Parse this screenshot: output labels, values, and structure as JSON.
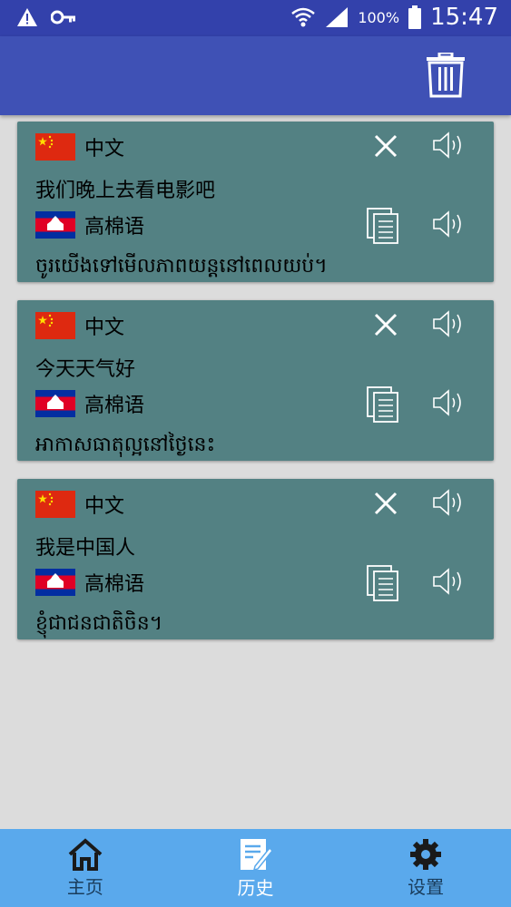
{
  "status": {
    "battery": "100%",
    "time": "15:47"
  },
  "cards": [
    {
      "source_lang": "中文",
      "source_text": "我们晚上去看电影吧",
      "target_lang": "高棉语",
      "target_text": "ចូរយើងទៅមើលភាពយន្តនៅពេលយប់។"
    },
    {
      "source_lang": "中文",
      "source_text": "今天天气好",
      "target_lang": "高棉语",
      "target_text": "អាកាសធាតុល្អនៅថ្ងៃនេះ"
    },
    {
      "source_lang": "中文",
      "source_text": "我是中国人",
      "target_lang": "高棉语",
      "target_text": "ខ្ញុំជាជនជាតិចិន។"
    }
  ],
  "nav": {
    "home": "主页",
    "history": "历史",
    "settings": "设置"
  },
  "colors": {
    "app_bar": "#3f51b5",
    "card": "#538183",
    "nav_bar": "#5aa9ec",
    "nav_active": "#ffffff",
    "nav_inactive": "#1a3d5c"
  }
}
